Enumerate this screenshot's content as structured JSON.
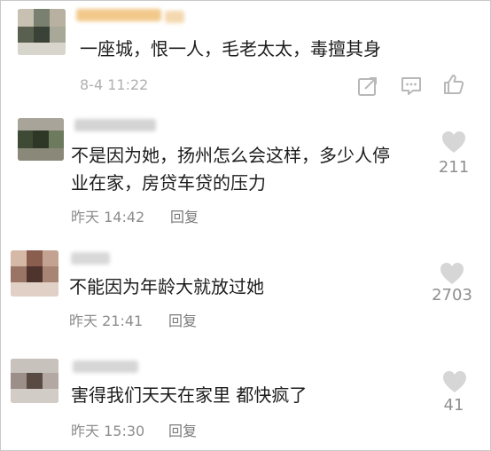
{
  "comments": [
    {
      "text_lines": [
        "一座城，恨一人，毛老太太，毒擅其身"
      ],
      "time": "8-4 11:22"
    },
    {
      "text_lines": [
        "不是因为她，扬州怎么会这样，多少人停",
        "业在家，房贷车贷的压力"
      ],
      "time": "昨天 14:42",
      "reply": "回复",
      "likes": "211"
    },
    {
      "text_lines": [
        "不能因为年龄大就放过她"
      ],
      "time": "昨天 21:41",
      "reply": "回复",
      "likes": "2703"
    },
    {
      "text_lines": [
        "害得我们天天在家里 都快疯了"
      ],
      "time": "昨天 15:30",
      "reply": "回复",
      "likes": "41"
    }
  ],
  "icons": {
    "share": "share-icon",
    "comment": "comment-icon",
    "like": "thumbs-up-icon",
    "heart": "heart-icon"
  },
  "colors": {
    "text": "#1c1c1c",
    "meta": "#8d8d8d",
    "icon": "#b8b8b8"
  }
}
